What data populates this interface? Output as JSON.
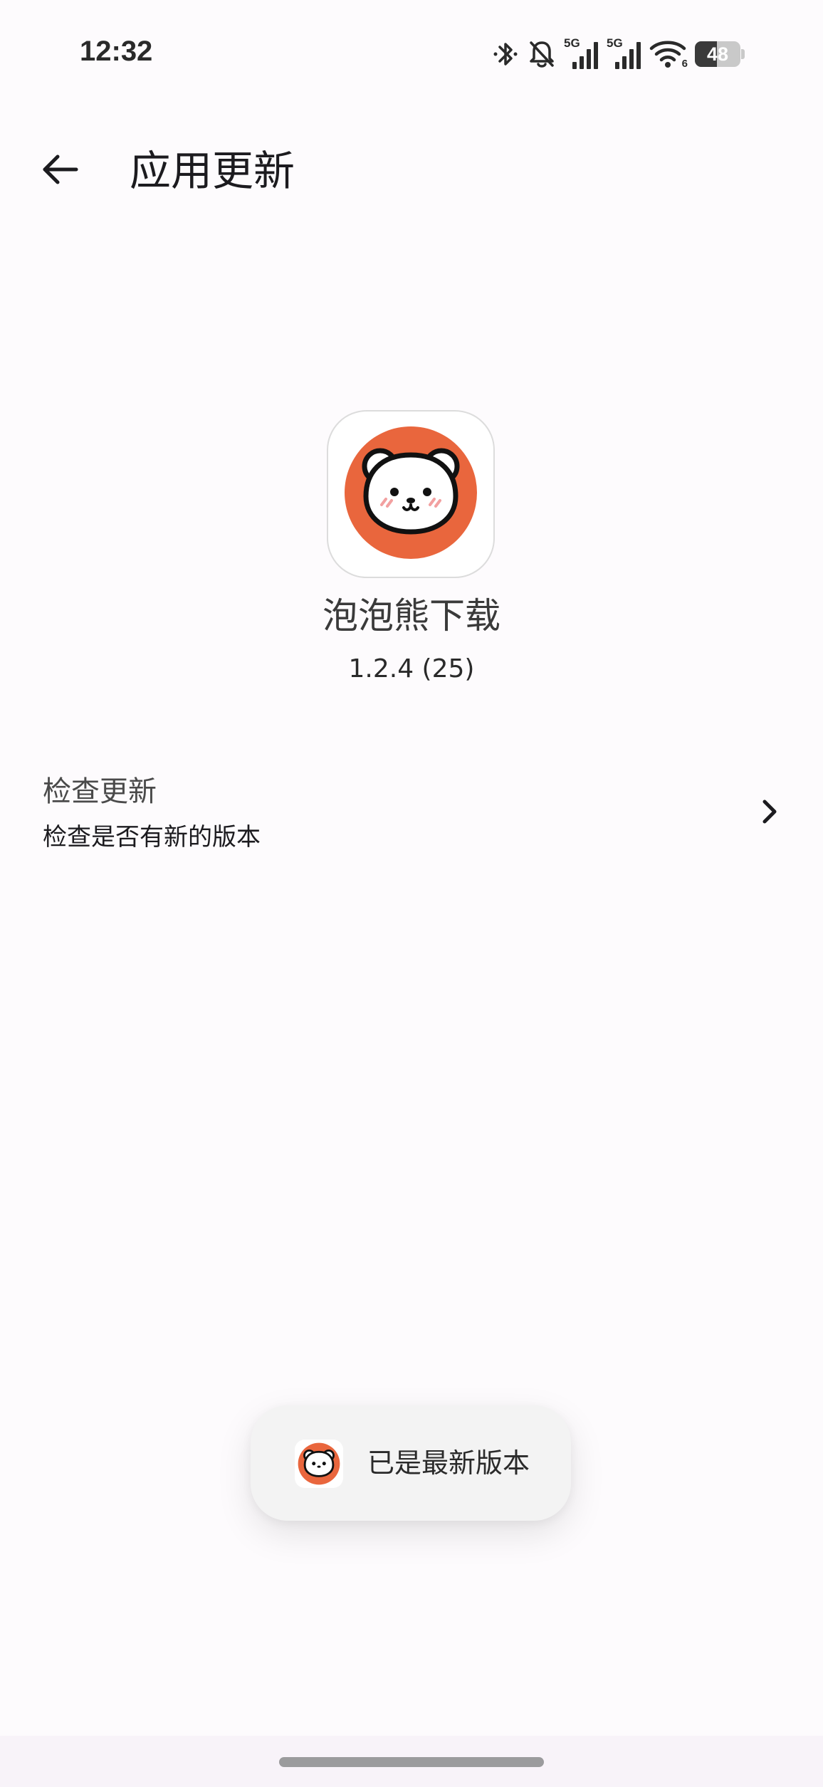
{
  "status_bar": {
    "time": "12:32",
    "network_1": "5G",
    "network_2": "5G",
    "wifi_badge": "6",
    "battery_level": "48",
    "battery_fraction": 0.48,
    "icons": [
      "bluetooth-icon",
      "bell-off-icon",
      "signal-5g-icon",
      "signal-5g-icon",
      "wifi-6-icon",
      "battery-icon"
    ]
  },
  "app_bar": {
    "title": "应用更新",
    "back_icon": "arrow-left-icon"
  },
  "app_info": {
    "name": "泡泡熊下载",
    "version": "1.2.4 (25)",
    "icon": "bear-face-icon",
    "icon_bg_color": "#E9663D"
  },
  "check_update": {
    "title": "检查更新",
    "subtitle": "检查是否有新的版本",
    "chevron_icon": "chevron-right-icon"
  },
  "toast": {
    "message": "已是最新版本",
    "icon": "bear-face-icon"
  },
  "colors": {
    "background": "#FDFBFD",
    "brand": "#E9663D",
    "toast_bg": "#F3F3F3",
    "nav_bar": "#F8F3F9"
  }
}
